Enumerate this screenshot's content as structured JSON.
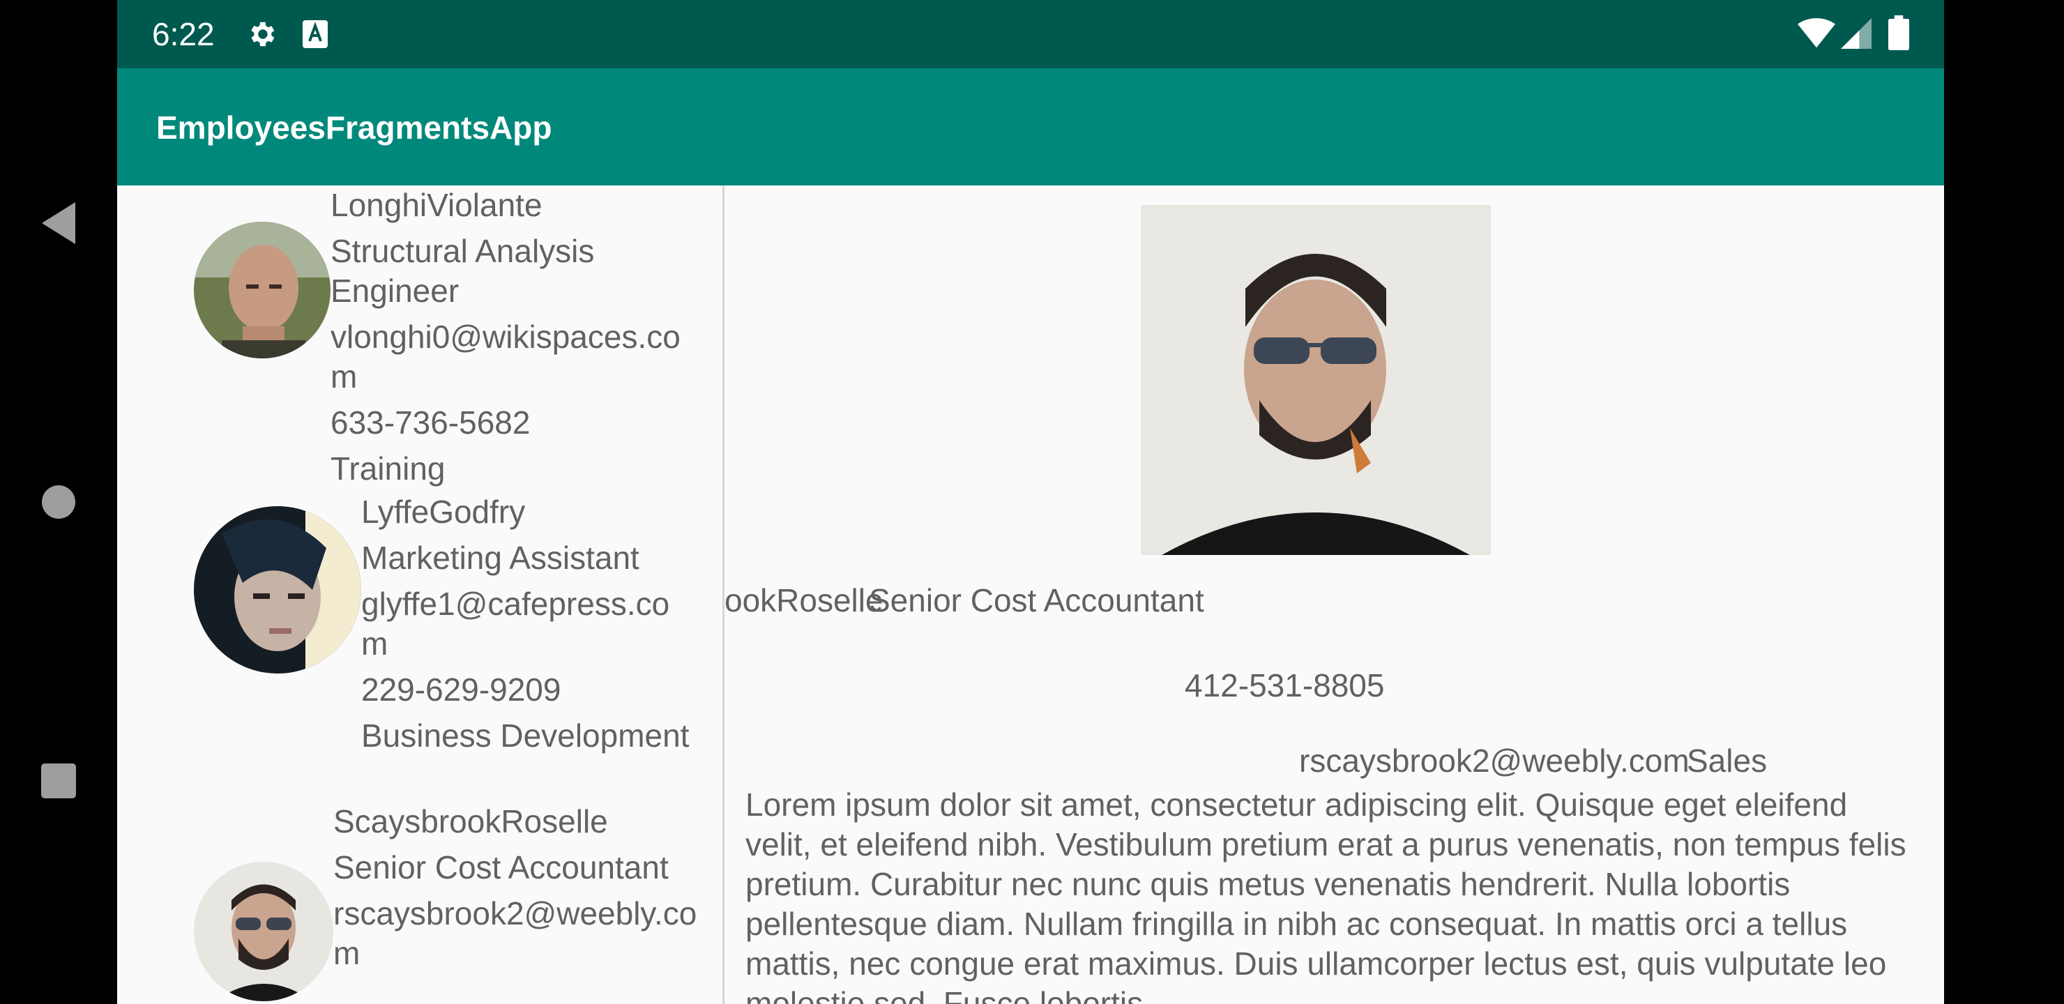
{
  "status_bar": {
    "time": "6:22"
  },
  "app": {
    "title": "EmployeesFragmentsApp"
  },
  "employees": [
    {
      "name": "LonghiViolante",
      "title": "Structural Analysis Engineer",
      "email": "vlonghi0@wikispaces.com",
      "phone": "633-736-5682",
      "department": "Training"
    },
    {
      "name": "LyffeGodfry",
      "title": "Marketing Assistant",
      "email": "glyffe1@cafepress.com",
      "phone": "229-629-9209",
      "department": "Business Development"
    },
    {
      "name": "ScaysbrookRoselle",
      "title": "Senior Cost Accountant",
      "email": "rscaysbrook2@weebly.com"
    }
  ],
  "detail": {
    "name_visible": "ookRoselle",
    "title": "Senior Cost Accountant",
    "phone": "412-531-8805",
    "email": "rscaysbrook2@weebly.com",
    "department": "Sales",
    "description": "Lorem ipsum dolor sit amet, consectetur adipiscing elit. Quisque eget eleifend velit, et eleifend nibh. Vestibulum pretium erat a purus venenatis, non tempus felis pretium. Curabitur nec nunc quis metus venenatis hendrerit. Nulla lobortis pellentesque diam. Nullam fringilla in nibh ac consequat. In mattis orci a tellus mattis, nec congue erat maximus. Duis ullamcorper lectus est, quis vulputate leo molestie sed. Fusce lobortis"
  },
  "icons": {
    "status_left": [
      "gear-icon",
      "a-icon"
    ],
    "status_right": [
      "wifi-icon",
      "signal-icon",
      "battery-icon"
    ],
    "nav": [
      "back-icon",
      "home-icon",
      "recents-icon"
    ]
  }
}
